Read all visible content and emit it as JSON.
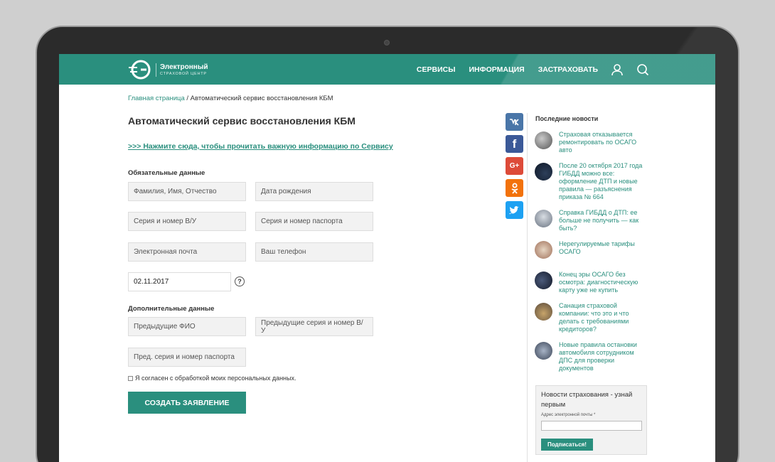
{
  "brand": {
    "name": "Электронный",
    "subtitle": "СТРАХОВОЙ ЦЕНТР",
    "accent": "#2a8f7e"
  },
  "nav": {
    "items": [
      "СЕРВИСЫ",
      "ИНФОРМАЦИЯ",
      "ЗАСТРАХОВАТЬ"
    ],
    "icons": [
      "user-icon",
      "search-icon"
    ]
  },
  "breadcrumb": {
    "home": "Главная страница",
    "separator": " / ",
    "current": "Автоматический сервис восстановления КБМ"
  },
  "page": {
    "title": "Автоматический сервис восстановления КБМ",
    "info_link": ">>> Нажмите сюда, чтобы прочитать важную информацию по Сервису"
  },
  "form": {
    "required_label": "Обязательные данные",
    "optional_label": "Дополнительные данные",
    "fields": {
      "full_name": "Фамилия, Имя, Отчество",
      "birth_date": "Дата рождения",
      "license": "Серия и номер В/У",
      "passport": "Серия и номер паспорта",
      "email": "Электронная почта",
      "phone": "Ваш телефон",
      "date_value": "02.11.2017",
      "prev_name": "Предыдущие ФИО",
      "prev_license": "Предыдущие серия и номер В/У",
      "prev_passport": "Пред. серия и номер паспорта"
    },
    "help": "?",
    "consent": "Я согласен с обработкой моих персональных данных.",
    "submit": "СОЗДАТЬ ЗАЯВЛЕНИЕ"
  },
  "social": [
    {
      "icon": "vk-icon",
      "glyph": "vk",
      "color": "#4a76a8"
    },
    {
      "icon": "facebook-icon",
      "glyph": "f",
      "color": "#3b5998"
    },
    {
      "icon": "google-plus-icon",
      "glyph": "G+",
      "color": "#dd4b39"
    },
    {
      "icon": "odnoklassniki-icon",
      "glyph": "ok",
      "color": "#f2720c"
    },
    {
      "icon": "twitter-icon",
      "glyph": "t",
      "color": "#1da1f2"
    }
  ],
  "sidebar": {
    "news_header": "Последние новости",
    "news": [
      "Страховая отказывается ремонтировать по ОСАГО авто",
      "После 20 октября 2017 года ГИБДД можно все: оформление ДТП и новые правила — разъяснения приказа № 664",
      "Справка ГИБДД о ДТП: ее больше не получить — как быть?",
      "Нерегулируемые тарифы ОСАГО",
      "Конец эры ОСАГО без осмотра: диагностическую карту уже не купить",
      "Санация страховой компании: что это и что делать с требованиями кредиторов?",
      "Новые правила остановки автомобиля сотрудником ДПС для проверки документов"
    ],
    "subscribe": {
      "title": "Новости страхования - узнай первым",
      "email_label": "Адрес электронной почты *",
      "button": "Подписаться!"
    }
  }
}
